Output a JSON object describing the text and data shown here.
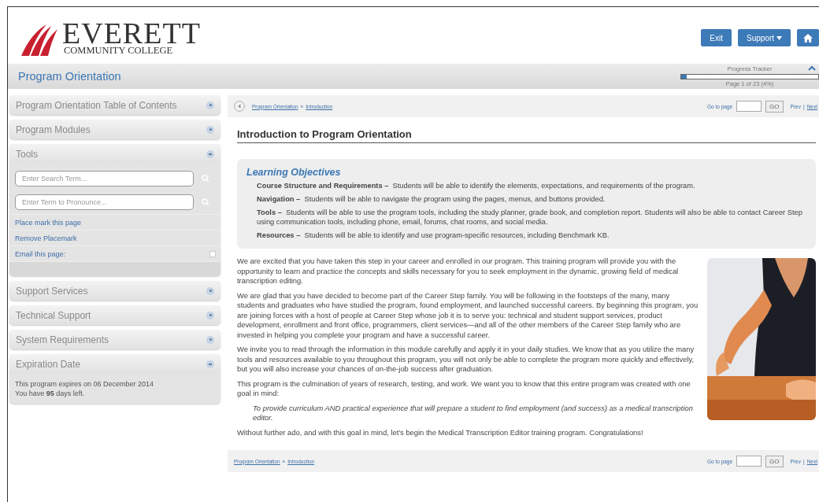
{
  "header": {
    "logo": {
      "name": "EVERETT",
      "subtitle": "COMMUNITY COLLEGE"
    },
    "buttons": [
      {
        "kind": "text",
        "label": "Exit"
      },
      {
        "kind": "dropdown",
        "label": "Support"
      },
      {
        "kind": "home"
      }
    ]
  },
  "title_bar": {
    "title": "Program Orientation",
    "progress": {
      "label": "Progress Tracker",
      "level": 0.04,
      "caption": "Page 1 of 23 (4%)"
    }
  },
  "sidebar": {
    "panels": [
      {
        "title": "Program Orientation Table of Contents",
        "expanded": false
      },
      {
        "title": "Program Modules",
        "expanded": false
      },
      {
        "title": "Tools",
        "expanded": true,
        "fields": [
          {
            "placeholder": "Enter Search Term..."
          },
          {
            "placeholder": "Enter Term to Pronounce..."
          }
        ],
        "links": [
          {
            "label": "Place mark this page",
            "expandable": false
          },
          {
            "label": "Remove Placemark",
            "expandable": false
          },
          {
            "label": "Email this page:",
            "expandable": true
          }
        ]
      },
      {
        "title": "Support Services",
        "expanded": false
      },
      {
        "title": "Technical Support",
        "expanded": false
      },
      {
        "title": "System Requirements",
        "expanded": false
      },
      {
        "title": "Expiration Date",
        "expanded": true,
        "lines": [
          "This program expires on 06 December 2014",
          "You have **95** days left."
        ]
      }
    ]
  },
  "top_nav": {
    "back_button": true,
    "breadcrumb": [
      "Program Orientation",
      "Introduction"
    ],
    "separator": "»",
    "goto_label": "Go to page",
    "go_button": "GO",
    "prev": "Prev",
    "pager_separator": "|",
    "next": "Next"
  },
  "content": {
    "title": "Introduction to Program Orientation",
    "objectives": {
      "title": "Learning Objectives",
      "items": [
        {
          "term": "Course Structure and Requirements –",
          "text": "Students will be able to identify the elements, expectations, and requirements of the program."
        },
        {
          "term": "Navigation –",
          "text": "Students will be able to navigate the program using the pages, menus, and buttons provided."
        },
        {
          "term": "Tools –",
          "text": "Students will be able to use the program tools, including the study planner, grade book, and completion report. Students will also be able to contact Career Step using communication tools, including phone, email, forums, chat rooms, and social media."
        },
        {
          "term": "Resources –",
          "text": "Students will be able to identify and use program-specific resources, including Benchmark KB."
        }
      ]
    },
    "paragraphs": [
      {
        "kind": "para",
        "text": "We are excited that you have taken this step in your career and enrolled in our program. This training program will provide you with the opportunity to learn and practice the concepts and skills necessary for you to seek employment in the dynamic, growing field of medical transcription editing."
      },
      {
        "kind": "para",
        "text": "We are glad that you have decided to become part of the Career Step family. You will be following in the footsteps of the many, many students and graduates who have studied the program, found employment, and launched successful careers. By beginning this program, you are joining forces with a host of people at Career Step whose job it is to serve you: technical and student support services, product development, enrollment and front office, programmers, client services—and all of the other members of the Career Step family who are invested in helping you complete your program and have a successful career."
      },
      {
        "kind": "para",
        "text": "We invite you to read through the information in this module carefully and apply it in your daily studies. We know that as you utilize the many tools and resources available to you throughout this program, you will not only be able to complete the program more quickly and effectively, but you will also increase your chances of on-the-job success after graduation."
      },
      {
        "kind": "para",
        "text": "This program is the culmination of years of research, testing, and work. We want you to know that this entire program was created with one goal in mind:"
      },
      {
        "kind": "quote",
        "text": "To provide curriculum AND practical experience that will prepare a student to find employment (and success) as a medical transcription editor."
      },
      {
        "kind": "para",
        "text": "Without further ado, and with this goal in mind, let's begin the Medical Transcription Editor training program. Congratulations!"
      }
    ]
  },
  "bottom_nav": {
    "back_button": false,
    "breadcrumb": [
      "Program Orientation",
      "Introduction"
    ],
    "separator": "»",
    "goto_label": "Go to page",
    "go_button": "GO",
    "prev": "Prev",
    "pager_separator": "|",
    "next": "Next"
  }
}
